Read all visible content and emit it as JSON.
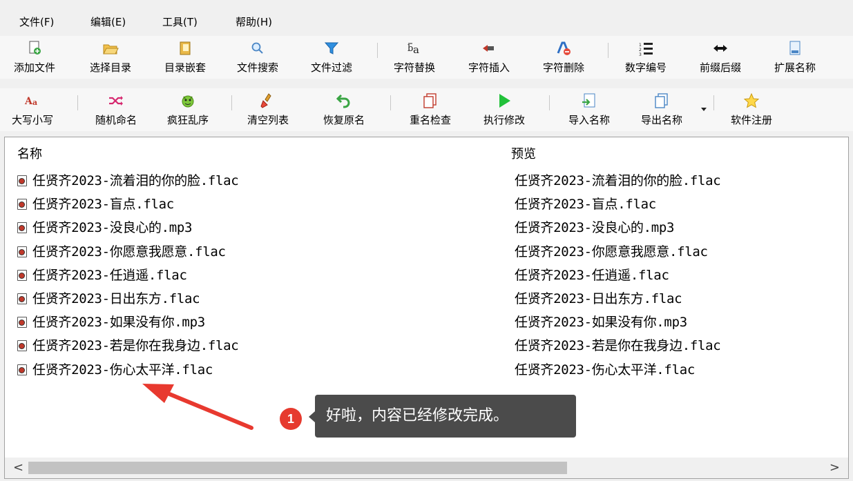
{
  "menu": [
    "文件(F)",
    "编辑(E)",
    "工具(T)",
    "帮助(H)"
  ],
  "toolbar1": [
    {
      "label": "添加文件",
      "icon": "add-file-icon"
    },
    {
      "label": "选择目录",
      "icon": "open-folder-icon"
    },
    {
      "label": "目录嵌套",
      "icon": "nested-folder-icon"
    },
    {
      "label": "文件搜索",
      "icon": "search-icon"
    },
    {
      "label": "文件过滤",
      "icon": "filter-icon"
    },
    {
      "label": "字符替换",
      "icon": "replace-icon"
    },
    {
      "label": "字符插入",
      "icon": "insert-icon"
    },
    {
      "label": "字符删除",
      "icon": "delete-char-icon"
    },
    {
      "label": "数字编号",
      "icon": "numbered-list-icon"
    },
    {
      "label": "前缀后缀",
      "icon": "prefix-suffix-icon"
    },
    {
      "label": "扩展名称",
      "icon": "extension-icon"
    }
  ],
  "toolbar2": [
    {
      "label": "大写小写",
      "icon": "case-icon"
    },
    {
      "label": "随机命名",
      "icon": "shuffle-icon"
    },
    {
      "label": "疯狂乱序",
      "icon": "crazy-shuffle-icon"
    },
    {
      "label": "清空列表",
      "icon": "clear-list-icon"
    },
    {
      "label": "恢复原名",
      "icon": "undo-icon"
    },
    {
      "label": "重名检查",
      "icon": "duplicate-check-icon"
    },
    {
      "label": "执行修改",
      "icon": "play-icon"
    },
    {
      "label": "导入名称",
      "icon": "import-icon"
    },
    {
      "label": "导出名称",
      "icon": "export-icon"
    },
    {
      "label": "软件注册",
      "icon": "star-icon"
    }
  ],
  "list": {
    "col_name": "名称",
    "col_preview": "预览",
    "files": [
      "任贤齐2023-流着泪的你的脸.flac",
      "任贤齐2023-盲点.flac",
      "任贤齐2023-没良心的.mp3",
      "任贤齐2023-你愿意我愿意.flac",
      "任贤齐2023-任逍遥.flac",
      "任贤齐2023-日出东方.flac",
      "任贤齐2023-如果没有你.mp3",
      "任贤齐2023-若是你在我身边.flac",
      "任贤齐2023-伤心太平洋.flac"
    ],
    "previews": [
      "任贤齐2023-流着泪的你的脸.flac",
      "任贤齐2023-盲点.flac",
      "任贤齐2023-没良心的.mp3",
      "任贤齐2023-你愿意我愿意.flac",
      "任贤齐2023-任逍遥.flac",
      "任贤齐2023-日出东方.flac",
      "任贤齐2023-如果没有你.mp3",
      "任贤齐2023-若是你在我身边.flac",
      "任贤齐2023-伤心太平洋.flac"
    ]
  },
  "scrollbar": {
    "left_arrow": "<",
    "right_arrow": ">"
  },
  "callout": {
    "number": "1",
    "text": "好啦，内容已经修改完成。"
  },
  "colors": {
    "callout_badge": "#e63a2e",
    "callout_box": "#4b4b4b",
    "arrow": "#e8392f"
  }
}
